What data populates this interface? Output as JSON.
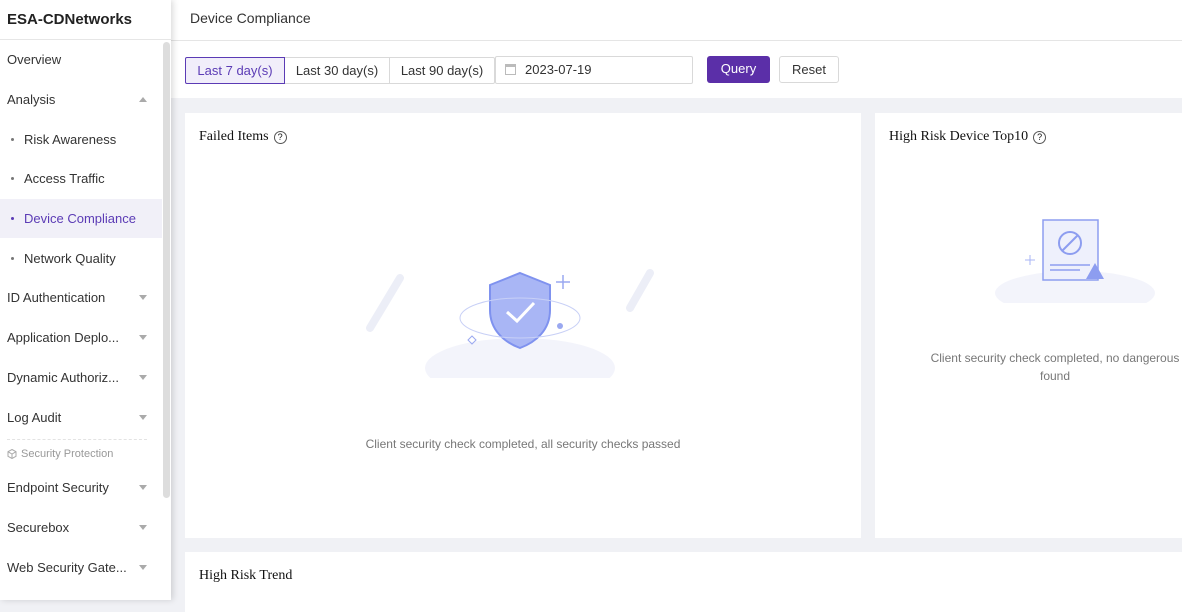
{
  "sidebar": {
    "brand": "ESA-CDNetworks",
    "items": [
      {
        "label": "Overview"
      },
      {
        "label": "Analysis"
      },
      {
        "label": "Risk Awareness"
      },
      {
        "label": "Access Traffic"
      },
      {
        "label": "Device Compliance"
      },
      {
        "label": "Network Quality"
      },
      {
        "label": "ID Authentication"
      },
      {
        "label": "Application Deplo..."
      },
      {
        "label": "Dynamic Authoriz..."
      },
      {
        "label": "Log Audit"
      }
    ],
    "group_label": "Security Protection",
    "group_items": [
      {
        "label": "Endpoint Security"
      },
      {
        "label": "Securebox"
      },
      {
        "label": "Web Security Gate..."
      }
    ]
  },
  "header": {
    "title": "Device Compliance"
  },
  "filter": {
    "ranges": [
      "Last 7 day(s)",
      "Last 30 day(s)",
      "Last 90 day(s)"
    ],
    "selected_range": "Last 7 day(s)",
    "date": "2023-07-19",
    "query_label": "Query",
    "reset_label": "Reset"
  },
  "cards": {
    "failed_items": {
      "title": "Failed Items",
      "empty_text": "Client security check completed, all security checks passed"
    },
    "top10": {
      "title": "High Risk Device Top10",
      "empty_text": "Client security check completed, no dangerous found"
    },
    "trend": {
      "title": "High Risk Trend"
    }
  },
  "colors": {
    "accent": "#5b3bb5"
  }
}
